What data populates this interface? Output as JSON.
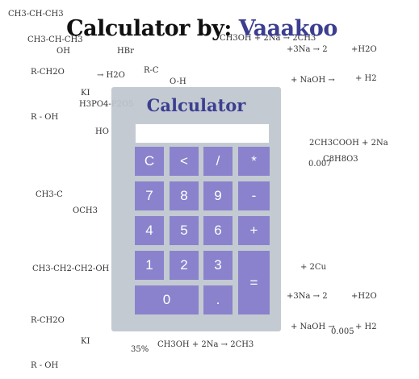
{
  "page": {
    "title_prefix": "Calculator by:",
    "author": "Vaaakoo"
  },
  "calculator": {
    "title": "Calculator",
    "display_value": "",
    "buttons": {
      "clear": "C",
      "backspace": "<",
      "divide": "/",
      "multiply": "*",
      "seven": "7",
      "eight": "8",
      "nine": "9",
      "minus": "-",
      "four": "4",
      "five": "5",
      "six": "6",
      "plus": "+",
      "one": "1",
      "two": "2",
      "three": "3",
      "equals": "=",
      "zero": "0",
      "decimal": "."
    }
  },
  "colors": {
    "button": "#8a82cc",
    "title_accent": "#3c3f8f",
    "frame": "#bec6ce"
  },
  "background": {
    "description_style": "handwritten organic chemistry formulas",
    "snippets": [
      "CH3-CH-CH3",
      "CH3-CH-CH3",
      "OH",
      "CH3OH + 2Na → 2CH3",
      "+3Na → 2",
      "+H2O",
      "R-CH2O",
      "HBr",
      "→ H2O",
      "R-C",
      "O-H",
      "+ NaOH →",
      "+ H2",
      "KI",
      "H3PO4-P2O5",
      "R - OH",
      "2CH3COOH + 2Na",
      "C8H8O3",
      "CH3-C",
      "OCH3",
      "HO",
      "CH3-CH2-CH2-OH",
      "+ 2Cu",
      "35%",
      "0.007",
      "0.005"
    ]
  }
}
